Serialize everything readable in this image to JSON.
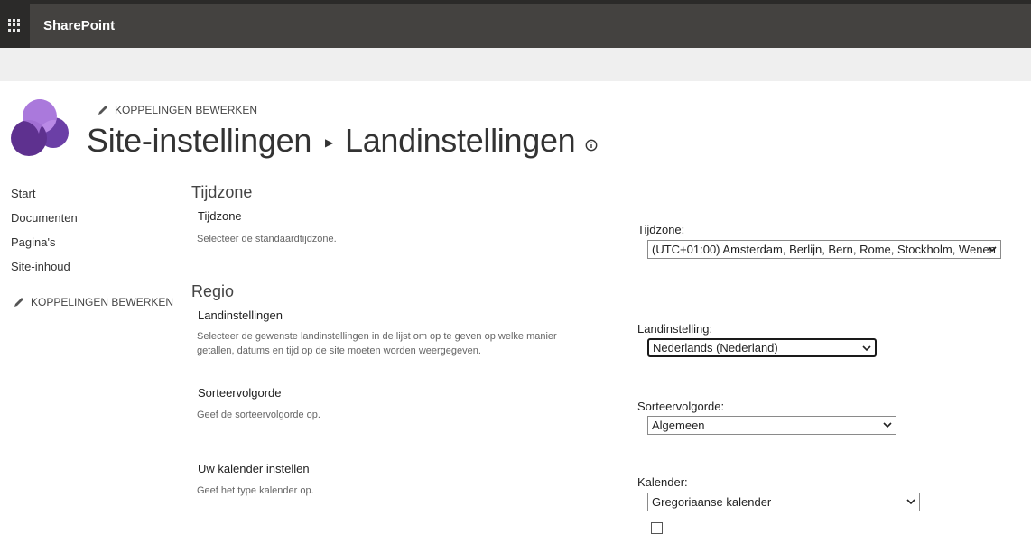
{
  "suite_bar": {
    "app_name": "SharePoint"
  },
  "header": {
    "edit_links": "KOPPELINGEN BEWERKEN",
    "breadcrumb_parent": "Site-instellingen",
    "breadcrumb_current": "Landinstellingen"
  },
  "quick_launch": {
    "items": [
      "Start",
      "Documenten",
      "Pagina's",
      "Site-inhoud"
    ],
    "edit_links": "KOPPELINGEN BEWERKEN"
  },
  "sections": {
    "timezone": {
      "heading": "Tijdzone",
      "label": "Tijdzone",
      "description": "Selecteer de standaardtijdzone.",
      "field_label": "Tijdzone:",
      "value": "(UTC+01:00) Amsterdam, Berlijn, Bern, Rome, Stockholm, Wenen"
    },
    "region": {
      "heading": "Regio",
      "locale": {
        "label": "Landinstellingen",
        "description": "Selecteer de gewenste landinstellingen in de lijst om op te geven op welke manier getallen, datums en tijd op de site moeten worden weergegeven.",
        "field_label": "Landinstelling:",
        "value": "Nederlands (Nederland)"
      },
      "sort": {
        "label": "Sorteervolgorde",
        "description": "Geef de sorteervolgorde op.",
        "field_label": "Sorteervolgorde:",
        "value": "Algemeen"
      },
      "calendar": {
        "label": "Uw kalender instellen",
        "description": "Geef het type kalender op.",
        "field_label": "Kalender:",
        "value": "Gregoriaanse kalender"
      }
    }
  },
  "colors": {
    "suite_bar": "#444240",
    "waffle": "#2b2a29",
    "logo": "#7b4fb5"
  }
}
